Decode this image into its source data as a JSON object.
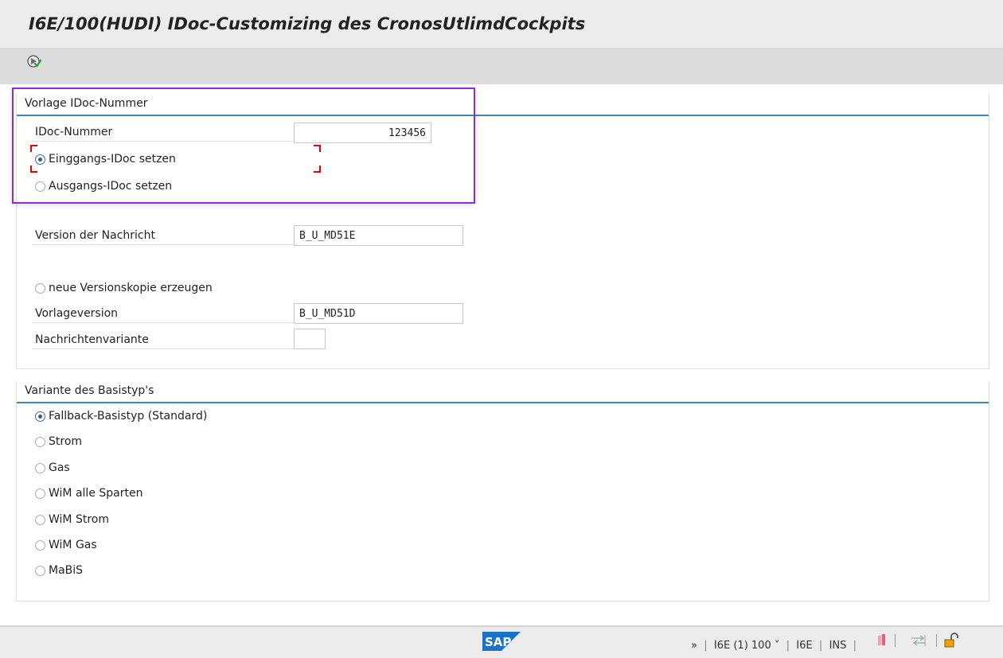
{
  "window": {
    "title": "I6E/100(HUDI) IDoc-Customizing des CronosUtlimdCockpits"
  },
  "toolbar": {
    "execute_icon": "execute-icon"
  },
  "group1": {
    "title": "Vorlage IDoc-Nummer",
    "idoc_label": "IDoc-Nummer",
    "idoc_value": "123456",
    "radio_in": "Einggangs-IDoc setzen",
    "radio_out": "Ausgangs-IDoc setzen",
    "version_label": "Version der Nachricht",
    "version_value": "B_U_MD51E",
    "radio_copy": "neue Versionskopie erzeugen",
    "template_label": "Vorlageversion",
    "template_value": "B_U_MD51D",
    "variant_label": "Nachrichtenvariante",
    "variant_value": ""
  },
  "group2": {
    "title": "Variante des Basistyp's",
    "options": [
      "Fallback-Basistyp (Standard)",
      "Strom",
      "Gas",
      "WiM alle Sparten",
      "WiM Strom",
      "WiM Gas",
      "MaBiS"
    ]
  },
  "statusbar": {
    "chevron": "»",
    "system": "I6E (1) 100",
    "dropdown": "˅",
    "client": "I6E",
    "mode": "INS",
    "sep": "|",
    "logo": "SAP"
  },
  "colors": {
    "accent": "#3a86b4",
    "highlight": "#8a2be2",
    "sap_blue": "#1a73c8"
  }
}
